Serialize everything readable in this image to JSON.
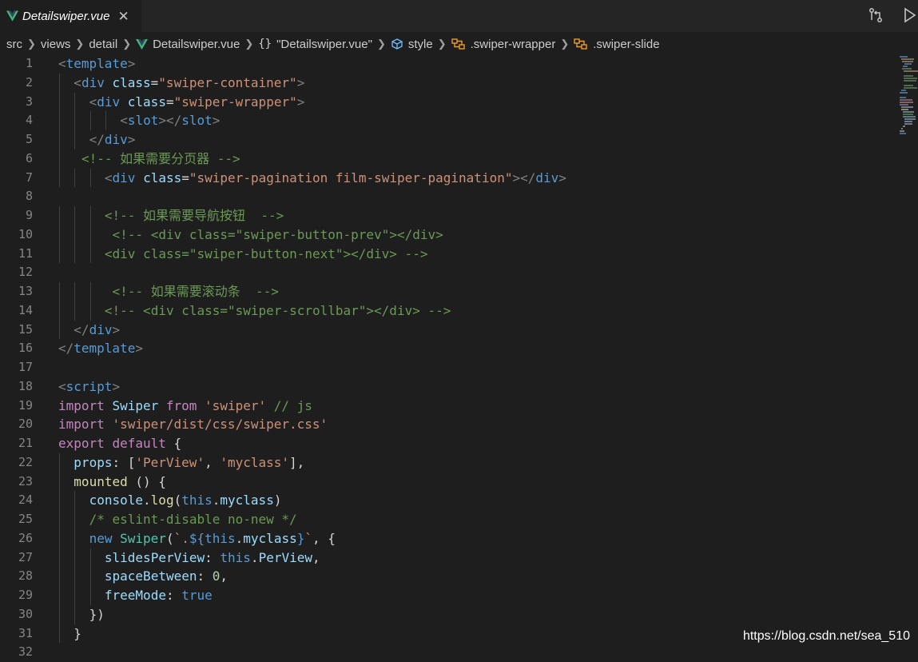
{
  "tab": {
    "label": "Detailswiper.vue"
  },
  "breadcrumb": {
    "items": [
      "src",
      "views",
      "detail",
      "Detailswiper.vue",
      "\"Detailswiper.vue\"",
      "style",
      ".swiper-wrapper",
      ".swiper-slide"
    ]
  },
  "colors": {
    "background": "#1e1e1e",
    "tag": "#569cd6",
    "attribute": "#9cdcfe",
    "string": "#ce9178",
    "comment": "#6a9955",
    "keyword": "#c586c0",
    "vue_green": "#41b883"
  },
  "editor": {
    "lines": [
      {
        "n": "1",
        "indent": 0,
        "tokens": [
          [
            "punc",
            "<"
          ],
          [
            "tag",
            "template"
          ],
          [
            "punc",
            ">"
          ]
        ]
      },
      {
        "n": "2",
        "indent": 1,
        "tokens": [
          [
            "punc",
            "<"
          ],
          [
            "tag",
            "div"
          ],
          [
            "def",
            " "
          ],
          [
            "attr",
            "class"
          ],
          [
            "def",
            "="
          ],
          [
            "str",
            "\"swiper-container\""
          ],
          [
            "punc",
            ">"
          ]
        ]
      },
      {
        "n": "3",
        "indent": 2,
        "tokens": [
          [
            "punc",
            "<"
          ],
          [
            "tag",
            "div"
          ],
          [
            "def",
            " "
          ],
          [
            "attr",
            "class"
          ],
          [
            "def",
            "="
          ],
          [
            "str",
            "\"swiper-wrapper\""
          ],
          [
            "punc",
            ">"
          ]
        ]
      },
      {
        "n": "4",
        "indent": 4,
        "tokens": [
          [
            "punc",
            "<"
          ],
          [
            "tag",
            "slot"
          ],
          [
            "punc",
            "></"
          ],
          [
            "tag",
            "slot"
          ],
          [
            "punc",
            ">"
          ]
        ]
      },
      {
        "n": "5",
        "indent": 2,
        "tokens": [
          [
            "punc",
            "</"
          ],
          [
            "tag",
            "div"
          ],
          [
            "punc",
            ">"
          ]
        ]
      },
      {
        "n": "6",
        "indent": 1.5,
        "tokens": [
          [
            "cmt",
            "<!-- 如果需要分页器 -->"
          ]
        ]
      },
      {
        "n": "7",
        "indent": 3,
        "tokens": [
          [
            "punc",
            "<"
          ],
          [
            "tag",
            "div"
          ],
          [
            "def",
            " "
          ],
          [
            "attr",
            "class"
          ],
          [
            "def",
            "="
          ],
          [
            "str",
            "\"swiper-pagination film-swiper-pagination\""
          ],
          [
            "punc",
            "></"
          ],
          [
            "tag",
            "div"
          ],
          [
            "punc",
            ">"
          ]
        ]
      },
      {
        "n": "8",
        "indent": 0,
        "tokens": []
      },
      {
        "n": "9",
        "indent": 3,
        "tokens": [
          [
            "cmt",
            "<!-- 如果需要导航按钮  -->"
          ]
        ]
      },
      {
        "n": "10",
        "indent": 3.5,
        "tokens": [
          [
            "cmt",
            "<!-- <div class=\"swiper-button-prev\"></div>"
          ]
        ]
      },
      {
        "n": "11",
        "indent": 3,
        "tokens": [
          [
            "cmt",
            "<div class=\"swiper-button-next\"></div> -->"
          ]
        ]
      },
      {
        "n": "12",
        "indent": 0,
        "tokens": []
      },
      {
        "n": "13",
        "indent": 3.5,
        "tokens": [
          [
            "cmt",
            "<!-- 如果需要滚动条  -->"
          ]
        ]
      },
      {
        "n": "14",
        "indent": 3,
        "tokens": [
          [
            "cmt",
            "<!-- <div class=\"swiper-scrollbar\"></div> -->"
          ]
        ]
      },
      {
        "n": "15",
        "indent": 1,
        "tokens": [
          [
            "punc",
            "</"
          ],
          [
            "tag",
            "div"
          ],
          [
            "punc",
            ">"
          ]
        ]
      },
      {
        "n": "16",
        "indent": 0,
        "tokens": [
          [
            "punc",
            "</"
          ],
          [
            "tag",
            "template"
          ],
          [
            "punc",
            ">"
          ]
        ]
      },
      {
        "n": "17",
        "indent": 0,
        "tokens": []
      },
      {
        "n": "18",
        "indent": 0,
        "tokens": [
          [
            "punc",
            "<"
          ],
          [
            "tag",
            "script"
          ],
          [
            "punc",
            ">"
          ]
        ]
      },
      {
        "n": "19",
        "indent": 0,
        "tokens": [
          [
            "kw",
            "import"
          ],
          [
            "def",
            " "
          ],
          [
            "var",
            "Swiper"
          ],
          [
            "def",
            " "
          ],
          [
            "kw",
            "from"
          ],
          [
            "def",
            " "
          ],
          [
            "str",
            "'swiper'"
          ],
          [
            "def",
            " "
          ],
          [
            "cmt",
            "// js"
          ]
        ]
      },
      {
        "n": "20",
        "indent": 0,
        "tokens": [
          [
            "kw",
            "import"
          ],
          [
            "def",
            " "
          ],
          [
            "str",
            "'swiper/dist/css/swiper.css'"
          ]
        ]
      },
      {
        "n": "21",
        "indent": 0,
        "tokens": [
          [
            "kw",
            "export"
          ],
          [
            "def",
            " "
          ],
          [
            "kw",
            "default"
          ],
          [
            "def",
            " {"
          ]
        ]
      },
      {
        "n": "22",
        "indent": 1,
        "tokens": [
          [
            "var",
            "props"
          ],
          [
            "def",
            ": ["
          ],
          [
            "str",
            "'PerView'"
          ],
          [
            "def",
            ", "
          ],
          [
            "str",
            "'myclass'"
          ],
          [
            "def",
            "],"
          ]
        ]
      },
      {
        "n": "23",
        "indent": 1,
        "tokens": [
          [
            "fn",
            "mounted"
          ],
          [
            "def",
            " () {"
          ]
        ]
      },
      {
        "n": "24",
        "indent": 2,
        "tokens": [
          [
            "var",
            "console"
          ],
          [
            "def",
            "."
          ],
          [
            "fn",
            "log"
          ],
          [
            "def",
            "("
          ],
          [
            "kw2",
            "this"
          ],
          [
            "def",
            "."
          ],
          [
            "var",
            "myclass"
          ],
          [
            "def",
            ")"
          ]
        ]
      },
      {
        "n": "25",
        "indent": 2,
        "tokens": [
          [
            "cmt",
            "/* eslint-disable no-new */"
          ]
        ]
      },
      {
        "n": "26",
        "indent": 2,
        "tokens": [
          [
            "kw2",
            "new"
          ],
          [
            "def",
            " "
          ],
          [
            "cls",
            "Swiper"
          ],
          [
            "def",
            "("
          ],
          [
            "str",
            "`."
          ],
          [
            "kw2",
            "${"
          ],
          [
            "kw2",
            "this"
          ],
          [
            "def",
            "."
          ],
          [
            "var",
            "myclass"
          ],
          [
            "kw2",
            "}"
          ],
          [
            "str",
            "`"
          ],
          [
            "def",
            ", {"
          ]
        ]
      },
      {
        "n": "27",
        "indent": 3,
        "tokens": [
          [
            "var",
            "slidesPerView"
          ],
          [
            "def",
            ": "
          ],
          [
            "kw2",
            "this"
          ],
          [
            "def",
            "."
          ],
          [
            "var",
            "PerView"
          ],
          [
            "def",
            ","
          ]
        ]
      },
      {
        "n": "28",
        "indent": 3,
        "tokens": [
          [
            "var",
            "spaceBetween"
          ],
          [
            "def",
            ": "
          ],
          [
            "num",
            "0"
          ],
          [
            "def",
            ","
          ]
        ]
      },
      {
        "n": "29",
        "indent": 3,
        "tokens": [
          [
            "var",
            "freeMode"
          ],
          [
            "def",
            ": "
          ],
          [
            "kw2",
            "true"
          ]
        ]
      },
      {
        "n": "30",
        "indent": 2,
        "tokens": [
          [
            "def",
            "})"
          ]
        ]
      },
      {
        "n": "31",
        "indent": 1,
        "tokens": [
          [
            "def",
            "}"
          ]
        ]
      },
      {
        "n": "32",
        "indent": 0,
        "tokens": []
      }
    ]
  },
  "watermark": "https://blog.csdn.net/sea_510"
}
